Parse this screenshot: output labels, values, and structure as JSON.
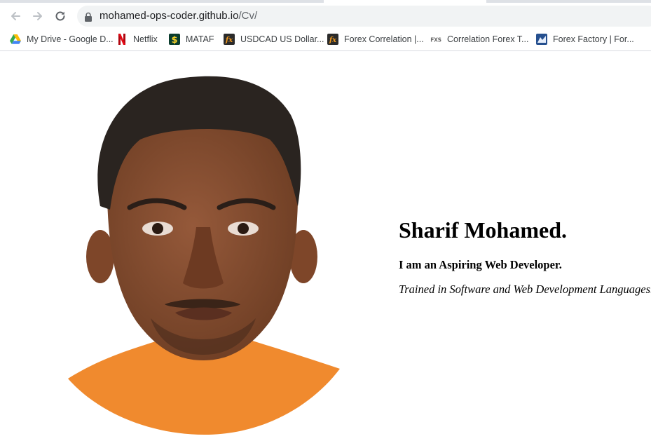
{
  "browser": {
    "address": {
      "host": "mohamed-ops-coder.github.io",
      "path": "/Cv/"
    },
    "bookmarks": [
      {
        "label": "My Drive - Google D...",
        "icon": "google-drive-icon"
      },
      {
        "label": "Netflix",
        "icon": "netflix-icon"
      },
      {
        "label": "MATAF",
        "icon": "mataf-dollar-icon"
      },
      {
        "label": "USDCAD US Dollar...",
        "icon": "fx-icon"
      },
      {
        "label": "Forex Correlation |...",
        "icon": "fx-icon"
      },
      {
        "label": "Correlation Forex T...",
        "icon": "fxs-icon"
      },
      {
        "label": "Forex Factory | For...",
        "icon": "forex-factory-icon"
      }
    ]
  },
  "page": {
    "name": "Sharif Mohamed.",
    "tagline": "I am an Aspiring Web Developer.",
    "subline": "Trained in Software and Web Development Languages."
  },
  "colors": {
    "shirt": "#f08a2e",
    "skin": "#8a5232",
    "hair": "#2a2420"
  }
}
